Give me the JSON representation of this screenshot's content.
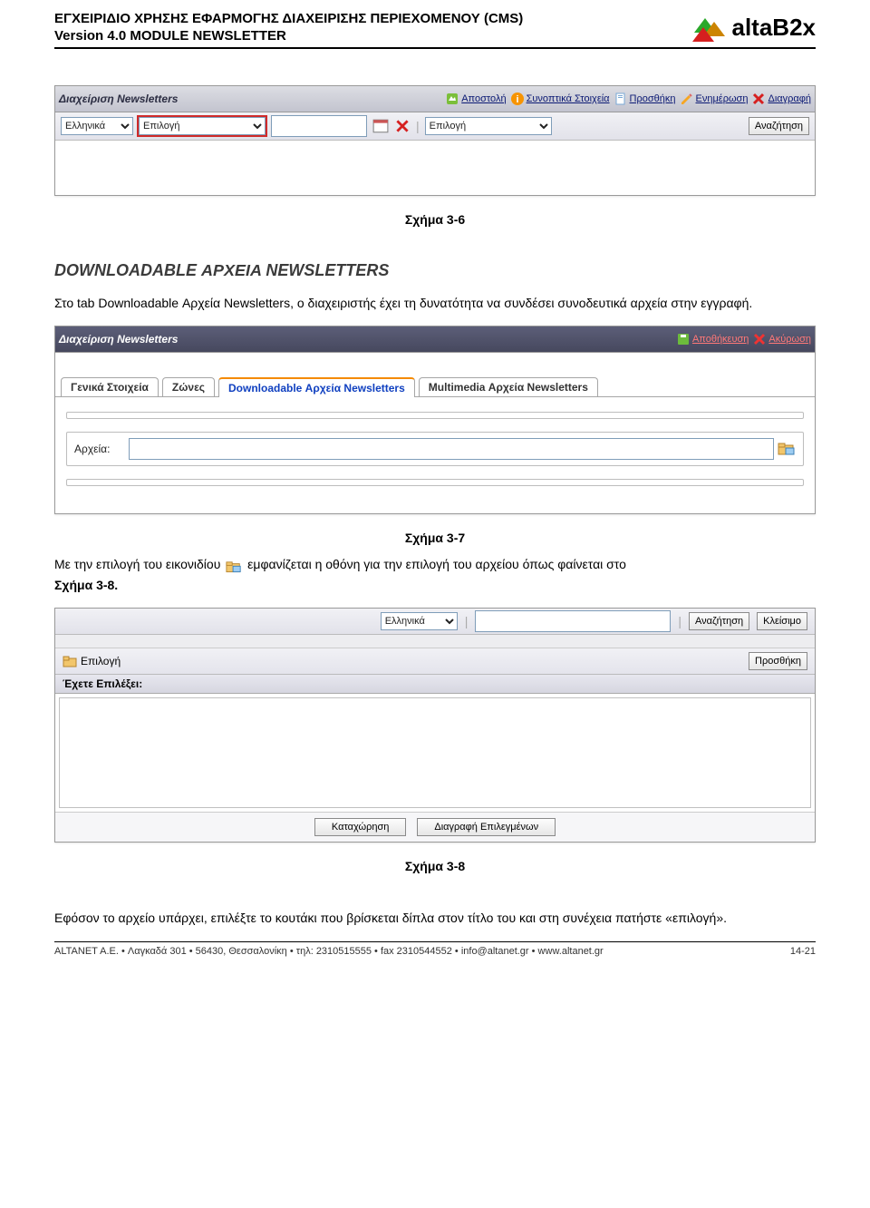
{
  "header": {
    "line1": "ΕΓΧΕΙΡΙΔΙΟ ΧΡΗΣΗΣ ΕΦΑΡΜΟΓΗΣ ΔΙΑΧΕΙΡΙΣΗΣ ΠΕΡΙΕΧΟΜΕΝΟΥ (CMS)",
    "line2": "Version 4.0 MODULE NEWSLETTER",
    "logo_text": "altaB2x"
  },
  "fig36": {
    "titlebar": "Διαχείριση Newsletters",
    "links": [
      "Αποστολή",
      "Συνοπτικά Στοιχεία",
      "Προσθήκη",
      "Ενημέρωση",
      "Διαγραφή"
    ],
    "lang_select": "Ελληνικά",
    "choice_select": "Επιλογή",
    "choice_select2": "Επιλογή",
    "search_btn": "Αναζήτηση",
    "caption": "Σχήμα 3-6"
  },
  "section": {
    "title": "DOWNLOADABLE ΑΡΧΕΙΑ NEWSLETTERS",
    "p1": "Στο tab Downloadable Αρχεία Newsletters, ο διαχειριστής έχει τη δυνατότητα να συνδέσει συνοδευτικά αρχεία στην εγγραφή."
  },
  "fig37": {
    "titlebar": "Διαχείριση Newsletters",
    "links": [
      "Αποθήκευση",
      "Ακύρωση"
    ],
    "tabs": [
      "Γενικά Στοιχεία",
      "Ζώνες",
      "Downloadable Αρχεία Newsletters",
      "Multimedia Αρχεία Newsletters"
    ],
    "field_label": "Αρχεία:",
    "caption": "Σχήμα 3-7"
  },
  "mid_para": {
    "a": "Με την επιλογή του εικονιδίου",
    "b": "εμφανίζεται η οθόνη για την επιλογή του αρχείου όπως φαίνεται στο",
    "ref": "Σχήμα 3-8."
  },
  "fig38": {
    "lang_select": "Ελληνικά",
    "search_btn": "Αναζήτηση",
    "close_btn": "Κλείσιμο",
    "choose_btn": "Επιλογή",
    "add_btn": "Προσθήκη",
    "chosen_label": "Έχετε Επιλέξει:",
    "submit_btn": "Καταχώρηση",
    "delete_btn": "Διαγραφή Επιλεγμένων",
    "caption": "Σχήμα 3-8"
  },
  "final_para": "Εφόσον το αρχείο υπάρχει, επιλέξτε το κουτάκι που βρίσκεται δίπλα στον τίτλο του και στη συνέχεια πατήστε «επιλογή».",
  "footer": {
    "left": "ALTANET A.E. • Λαγκαδά 301 • 56430, Θεσσαλονίκη • τηλ: 2310515555 • fax 2310544552 • info@altanet.gr • www.altanet.gr",
    "right": "14-21"
  }
}
